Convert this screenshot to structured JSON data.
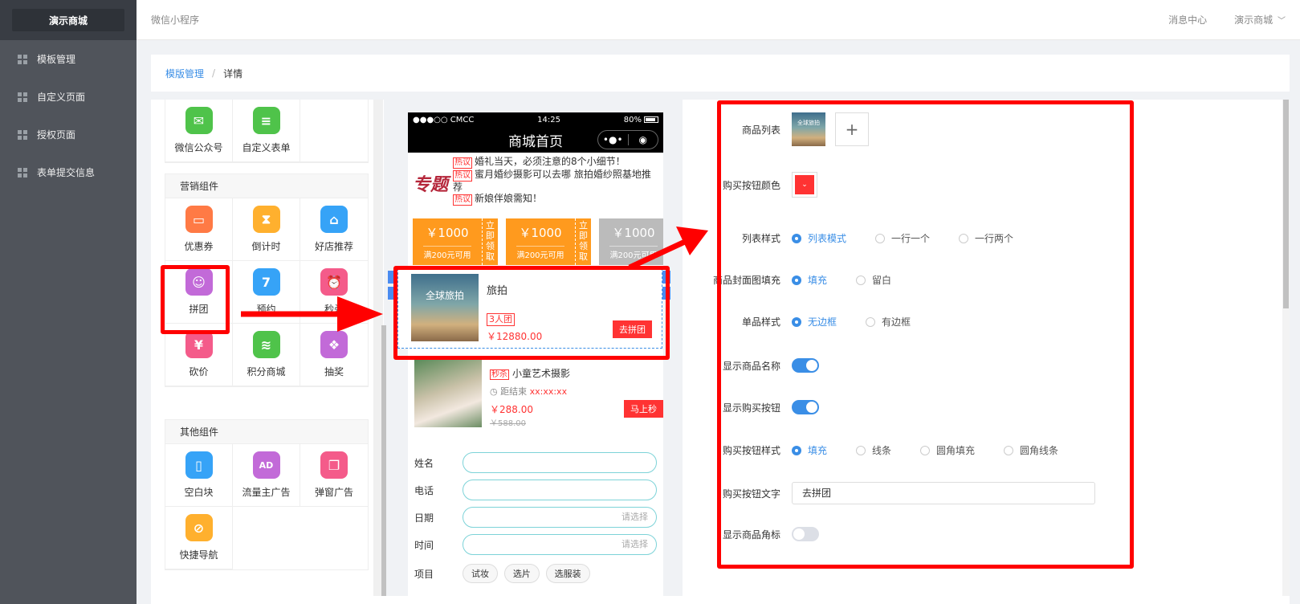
{
  "sidebar": {
    "brand": "演示商城",
    "items": [
      {
        "label": "模板管理"
      },
      {
        "label": "自定义页面"
      },
      {
        "label": "授权页面"
      },
      {
        "label": "表单提交信息"
      }
    ]
  },
  "topbar": {
    "app_label": "微信小程序",
    "messages": "消息中心",
    "store": "演示商城",
    "chevron": "﹀"
  },
  "breadcrumb": {
    "parent": "模版管理",
    "sep": "/",
    "current": "详情"
  },
  "components": {
    "top_row": [
      {
        "label": "微信公众号",
        "icon": "wechat-icon",
        "color": "#4fc34a",
        "glyph": "✉"
      },
      {
        "label": "自定义表单",
        "icon": "form-icon",
        "color": "#4fc34a",
        "glyph": "≡"
      }
    ],
    "marketing": {
      "title": "营销组件",
      "items": [
        {
          "label": "优惠券",
          "icon": "coupon-icon",
          "color": "#ff7a45",
          "glyph": "▭"
        },
        {
          "label": "倒计时",
          "icon": "hourglass-icon",
          "color": "#ffb02e",
          "glyph": "⧗"
        },
        {
          "label": "好店推荐",
          "icon": "shop-icon",
          "color": "#36a3f7",
          "glyph": "⌂"
        },
        {
          "label": "拼团",
          "icon": "group-icon",
          "color": "#c26ad8",
          "glyph": "☺"
        },
        {
          "label": "预约",
          "icon": "calendar-icon",
          "color": "#36a3f7",
          "glyph": "7"
        },
        {
          "label": "秒杀",
          "icon": "alarm-clock-icon",
          "color": "#f45b8a",
          "glyph": "⏰"
        },
        {
          "label": "砍价",
          "icon": "yen-icon",
          "color": "#f45b8a",
          "glyph": "¥"
        },
        {
          "label": "积分商城",
          "icon": "coins-icon",
          "color": "#4fc34a",
          "glyph": "≋"
        },
        {
          "label": "抽奖",
          "icon": "gift-icon",
          "color": "#c26ad8",
          "glyph": "❖"
        }
      ]
    },
    "other": {
      "title": "其他组件",
      "items": [
        {
          "label": "空白块",
          "icon": "blank-block-icon",
          "color": "#36a3f7",
          "glyph": "▯"
        },
        {
          "label": "流量主广告",
          "icon": "ad-icon",
          "color": "#c26ad8",
          "glyph": "AD"
        },
        {
          "label": "弹窗广告",
          "icon": "popup-icon",
          "color": "#f45b8a",
          "glyph": "❐"
        },
        {
          "label": "快捷导航",
          "icon": "compass-icon",
          "color": "#ffb02e",
          "glyph": "⊘"
        }
      ]
    }
  },
  "phone": {
    "carrier": "●●●○○ CMCC",
    "time": "14:25",
    "battery": "80%",
    "title": "商城首页",
    "capsule_more": "•●•",
    "capsule_close": "◉",
    "topic": {
      "logo": "专题",
      "tag": "热议",
      "lines": [
        "婚礼当天，必须注意的8个小细节！",
        "蜜月婚纱摄影可以去哪 旅拍婚纱照基地推荐",
        "新娘伴娘需知！"
      ]
    },
    "coupons": [
      {
        "value": "￥1000",
        "cond": "满200元可用",
        "action": "立即领取"
      },
      {
        "value": "￥1000",
        "cond": "满200元可用",
        "action": "立即领取"
      },
      {
        "value": "￥1000",
        "cond": "满200元可用",
        "action": ""
      }
    ],
    "group": {
      "image_caption": "全球旅拍",
      "title": "旅拍",
      "tag": "3人团",
      "price": "￥12880.00",
      "button": "去拼团"
    },
    "seckill": {
      "tag": "秒杀",
      "title": "小童艺术摄影",
      "countdown_label": "◷ 距结束",
      "countdown_value": "xx:xx:xx",
      "price": "￥288.00",
      "orig_price": "￥588.00",
      "button": "马上秒"
    },
    "form": {
      "name": "姓名",
      "phone": "电话",
      "date": "日期",
      "date_placeholder": "请选择",
      "time": "时间",
      "time_placeholder": "请选择",
      "project": "项目",
      "options": [
        "试妆",
        "选片",
        "选服装"
      ]
    }
  },
  "config": {
    "product_list": {
      "label": "商品列表",
      "thumb_caption": "全球旅拍",
      "add": "+"
    },
    "buy_btn_color": {
      "label": "购买按钮颜色",
      "chevron": "⌄",
      "color": "#ff3333"
    },
    "list_style": {
      "label": "列表样式",
      "options": [
        "列表模式",
        "一行一个",
        "一行两个"
      ],
      "selected": 0
    },
    "cover_fill": {
      "label": "商品封面图填充",
      "options": [
        "填充",
        "留白"
      ],
      "selected": 0
    },
    "item_style": {
      "label": "单品样式",
      "options": [
        "无边框",
        "有边框"
      ],
      "selected": 0
    },
    "show_name": {
      "label": "显示商品名称",
      "on": true
    },
    "show_buy": {
      "label": "显示购买按钮",
      "on": true
    },
    "buy_btn_style": {
      "label": "购买按钮样式",
      "options": [
        "填充",
        "线条",
        "圆角填充",
        "圆角线条"
      ],
      "selected": 0
    },
    "buy_btn_text": {
      "label": "购买按钮文字",
      "value": "去拼团"
    },
    "show_corner": {
      "label": "显示商品角标",
      "on": false
    }
  },
  "colors": {
    "accent": "#3a8ee6",
    "highlight": "#ff0000",
    "sidebar": "#50545b"
  }
}
